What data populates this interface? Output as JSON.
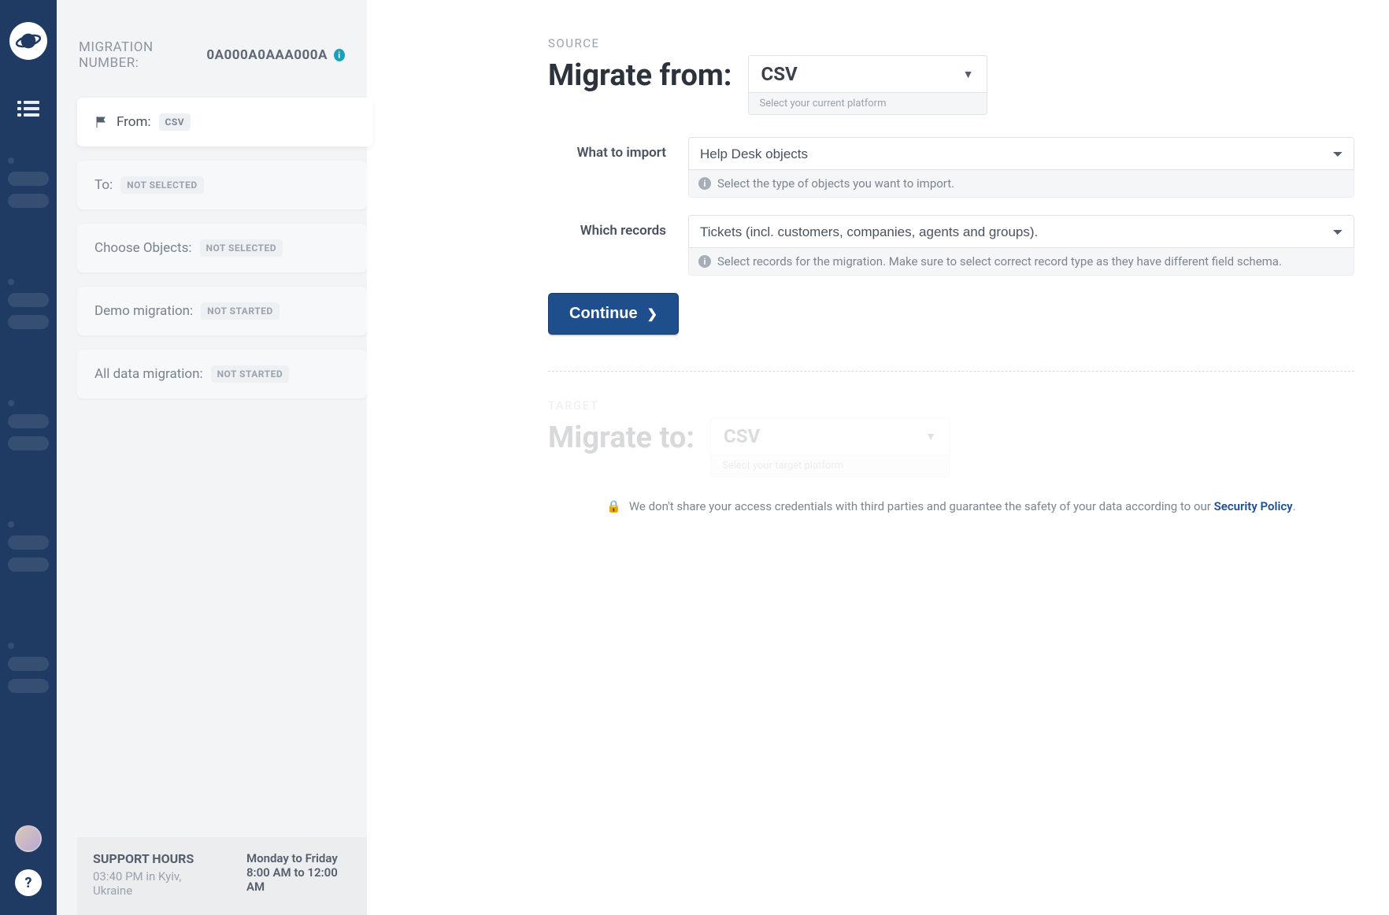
{
  "header": {
    "migration_number_label": "MIGRATION NUMBER:",
    "migration_number_value": "0A000A0AAA000A"
  },
  "steps": {
    "from": {
      "label": "From:",
      "badge": "CSV"
    },
    "to": {
      "label": "To:",
      "badge": "NOT SELECTED"
    },
    "choose": {
      "label": "Choose Objects:",
      "badge": "NOT SELECTED"
    },
    "demo": {
      "label": "Demo migration:",
      "badge": "NOT STARTED"
    },
    "all": {
      "label": "All data migration:",
      "badge": "NOT STARTED"
    }
  },
  "support": {
    "title": "SUPPORT HOURS",
    "time": "03:40 PM in Kyiv, Ukraine",
    "days": "Monday to Friday",
    "hours": "8:00 AM to 12:00 AM"
  },
  "source": {
    "eyebrow": "SOURCE",
    "label": "Migrate from:",
    "platform_value": "CSV",
    "platform_hint": "Select your current platform",
    "import": {
      "label": "What to import",
      "value": "Help Desk objects",
      "hint": "Select the type of objects you want to import."
    },
    "records": {
      "label": "Which records",
      "value": "Tickets (incl. customers, companies, agents and groups).",
      "hint": "Select records for the migration. Make sure to select correct record type as they have different field schema."
    },
    "continue": "Continue"
  },
  "target": {
    "eyebrow": "TARGET",
    "label": "Migrate to:",
    "platform_value": "CSV",
    "platform_hint": "Select your target platform"
  },
  "security": {
    "text_prefix": "We don't share your access credentials with third parties and guarantee the safety of your data according to our ",
    "link": "Security Policy",
    "text_suffix": "."
  }
}
